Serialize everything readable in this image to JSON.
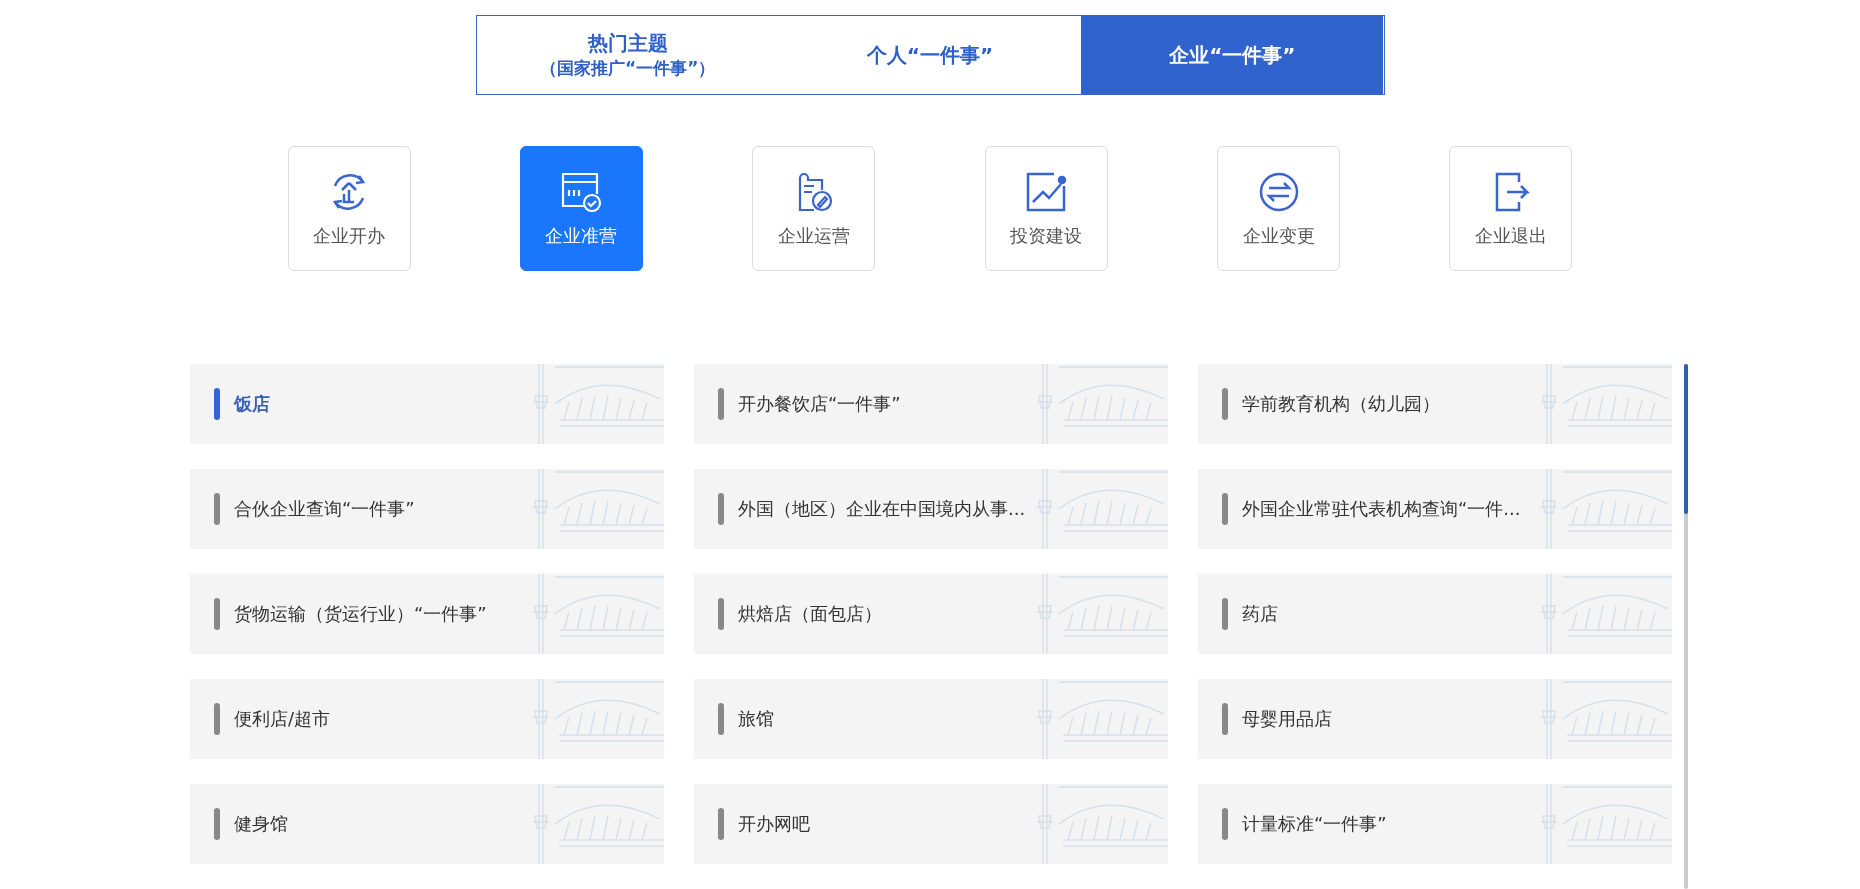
{
  "tabs": [
    {
      "label": "热门主题",
      "sublabel": "（国家推广“一件事”）",
      "selected": false
    },
    {
      "label": "个人“一件事”",
      "selected": false
    },
    {
      "label": "企业“一件事”",
      "selected": true
    }
  ],
  "categories": [
    {
      "label": "企业开办",
      "kind": "open",
      "selected": false
    },
    {
      "label": "企业准营",
      "kind": "permit",
      "selected": true
    },
    {
      "label": "企业运营",
      "kind": "operate",
      "selected": false
    },
    {
      "label": "投资建设",
      "kind": "invest",
      "selected": false
    },
    {
      "label": "企业变更",
      "kind": "change",
      "selected": false
    },
    {
      "label": "企业退出",
      "kind": "exit",
      "selected": false
    }
  ],
  "items": [
    {
      "label": "饭店",
      "selected": true
    },
    {
      "label": "开办餐饮店“一件事”",
      "selected": false
    },
    {
      "label": "学前教育机构（幼儿园）",
      "selected": false
    },
    {
      "label": "合伙企业查询“一件事”",
      "selected": false
    },
    {
      "label": "外国（地区）企业在中国境内从事...",
      "selected": false
    },
    {
      "label": "外国企业常驻代表机构查询“一件...",
      "selected": false
    },
    {
      "label": "货物运输（货运行业）“一件事”",
      "selected": false
    },
    {
      "label": "烘焙店（面包店）",
      "selected": false
    },
    {
      "label": "药店",
      "selected": false
    },
    {
      "label": "便利店/超市",
      "selected": false
    },
    {
      "label": "旅馆",
      "selected": false
    },
    {
      "label": "母婴用品店",
      "selected": false
    },
    {
      "label": "健身馆",
      "selected": false
    },
    {
      "label": "开办网吧",
      "selected": false
    },
    {
      "label": "计量标准“一件事”",
      "selected": false
    }
  ]
}
